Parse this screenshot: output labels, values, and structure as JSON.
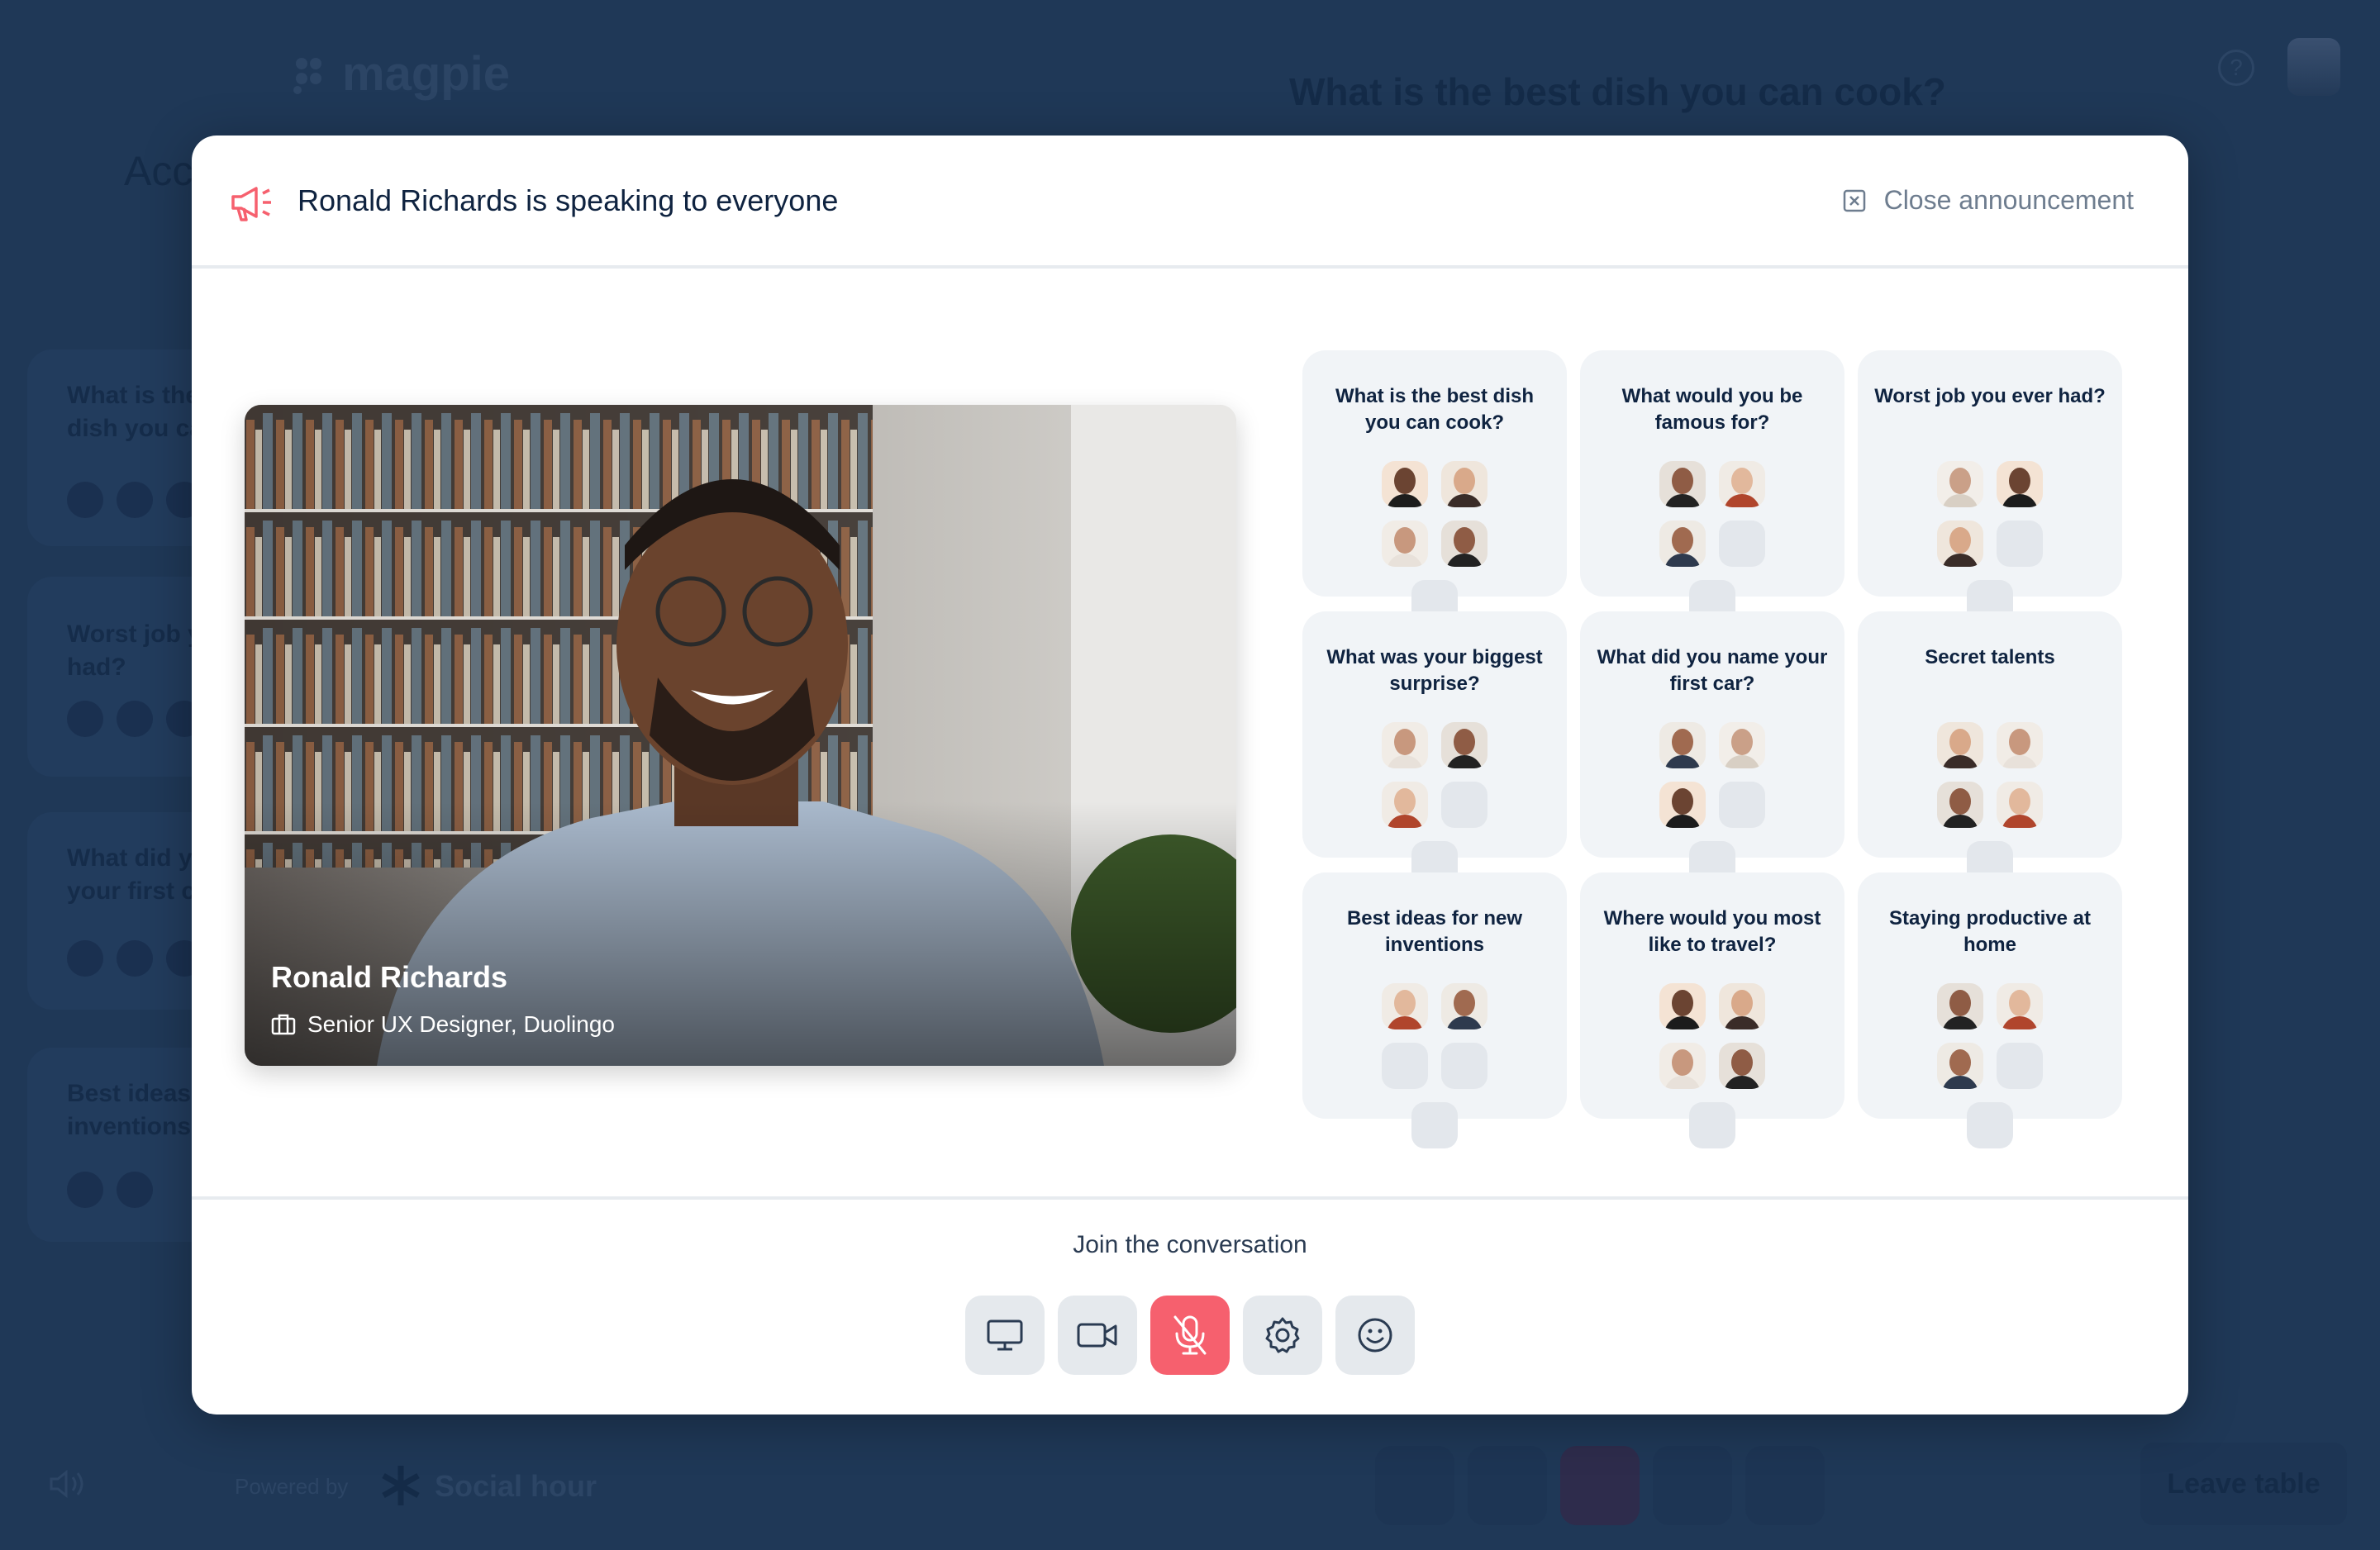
{
  "background": {
    "logo": "magpie",
    "question_title": "What is the best dish you can cook?",
    "help_icon": "question-circle-icon",
    "section_title_partial": "Acc",
    "sidebar_tables": [
      {
        "title": "What is the best dish you can cook?"
      },
      {
        "title": "Worst job you ever had?"
      },
      {
        "title": "What did you name your first car?"
      },
      {
        "title": "Best ideas for new inventions"
      }
    ],
    "powered_by": "Powered by",
    "brand": "Social hour",
    "leave_table": "Leave table"
  },
  "announcement": {
    "title": "Ronald Richards is speaking to everyone",
    "close_label": "Close announcement",
    "accent_color": "#f6606e",
    "speaker": {
      "name": "Ronald Richards",
      "role": "Senior UX Designer, Duolingo"
    },
    "tables": [
      {
        "title": "What is the best dish you can cook?",
        "occupied": 4,
        "seats": 5
      },
      {
        "title": "What would you be famous for?",
        "occupied": 3,
        "seats": 5
      },
      {
        "title": "Worst job you ever had?",
        "occupied": 3,
        "seats": 5
      },
      {
        "title": "What was your biggest surprise?",
        "occupied": 3,
        "seats": 5
      },
      {
        "title": "What did you name your first car?",
        "occupied": 3,
        "seats": 5
      },
      {
        "title": "Secret talents",
        "occupied": 4,
        "seats": 5
      },
      {
        "title": "Best ideas for new inventions",
        "occupied": 2,
        "seats": 5
      },
      {
        "title": "Where would you most like to travel?",
        "occupied": 4,
        "seats": 5
      },
      {
        "title": "Staying productive at home",
        "occupied": 3,
        "seats": 5
      }
    ],
    "join_label": "Join the conversation",
    "controls": [
      {
        "icon": "monitor-icon",
        "state": "off"
      },
      {
        "icon": "video-camera-icon",
        "state": "off"
      },
      {
        "icon": "microphone-muted-icon",
        "state": "muted"
      },
      {
        "icon": "gear-icon",
        "state": "off"
      },
      {
        "icon": "smiley-icon",
        "state": "off"
      }
    ]
  }
}
